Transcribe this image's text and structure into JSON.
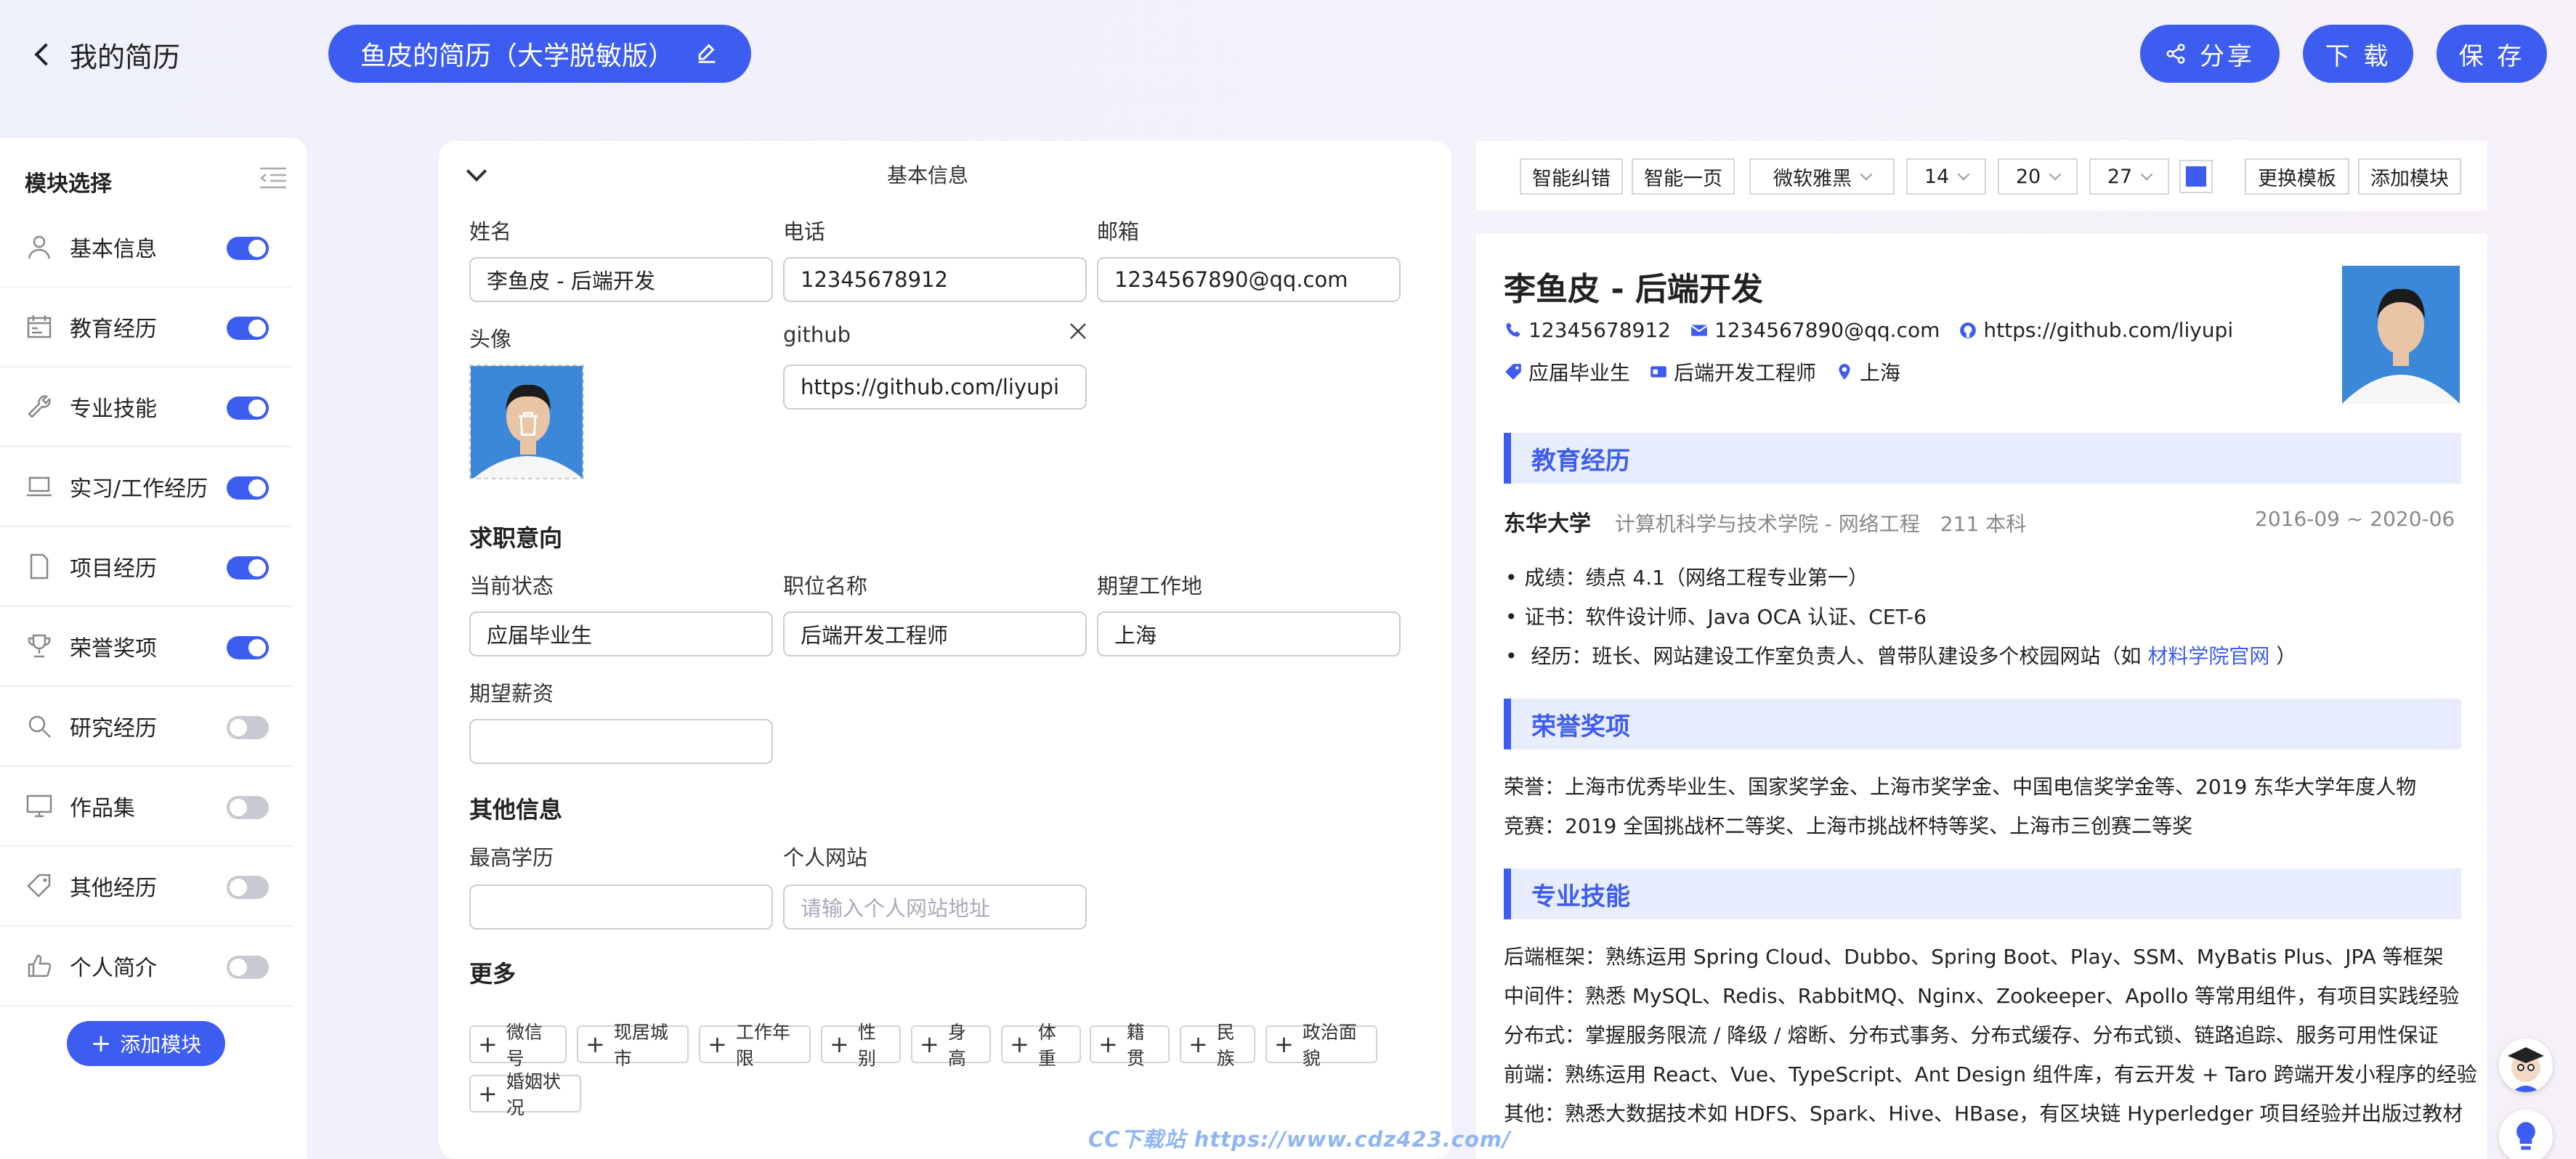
{
  "header": {
    "back_label": "我的简历",
    "resume_title": "鱼皮的简历（大学脱敏版）",
    "share_label": "分享",
    "download_label": "下 载",
    "save_label": "保 存"
  },
  "sidebar": {
    "title": "模块选择",
    "items": [
      {
        "label": "基本信息",
        "icon": "user-icon",
        "enabled": true
      },
      {
        "label": "教育经历",
        "icon": "calendar-icon",
        "enabled": true
      },
      {
        "label": "专业技能",
        "icon": "wrench-icon",
        "enabled": true
      },
      {
        "label": "实习/工作经历",
        "icon": "laptop-icon",
        "enabled": true
      },
      {
        "label": "项目经历",
        "icon": "file-icon",
        "enabled": true
      },
      {
        "label": "荣誉奖项",
        "icon": "trophy-icon",
        "enabled": true
      },
      {
        "label": "研究经历",
        "icon": "search-icon",
        "enabled": false
      },
      {
        "label": "作品集",
        "icon": "desktop-icon",
        "enabled": false
      },
      {
        "label": "其他经历",
        "icon": "tag-icon",
        "enabled": false
      },
      {
        "label": "个人简介",
        "icon": "thumbs-up-icon",
        "enabled": false
      }
    ],
    "add_module_label": "添加模块"
  },
  "form": {
    "section_title": "基本信息",
    "name_label": "姓名",
    "name_value": "李鱼皮 - 后端开发",
    "phone_label": "电话",
    "phone_value": "12345678912",
    "email_label": "邮箱",
    "email_value": "1234567890@qq.com",
    "avatar_label": "头像",
    "github_label": "github",
    "github_value": "https://github.com/liyupi",
    "intent_title": "求职意向",
    "status_label": "当前状态",
    "status_value": "应届毕业生",
    "position_label": "职位名称",
    "position_value": "后端开发工程师",
    "location_label": "期望工作地",
    "location_value": "上海",
    "salary_label": "期望薪资",
    "salary_value": "",
    "other_title": "其他信息",
    "degree_label": "最高学历",
    "degree_value": "",
    "website_label": "个人网站",
    "website_placeholder": "请输入个人网站地址",
    "more_title": "更多",
    "more_tags": [
      "微信号",
      "现居城市",
      "工作年限",
      "性别",
      "身高",
      "体重",
      "籍贯",
      "民族",
      "政治面貌",
      "婚姻状况"
    ]
  },
  "toolbar": {
    "smart_fix": "智能纠错",
    "smart_page": "智能一页",
    "font": "微软雅黑",
    "font_size": "14",
    "line_height": "20",
    "spacing": "27",
    "theme_color": "#3d5cf0",
    "change_template": "更换模板",
    "add_module": "添加模块"
  },
  "preview": {
    "name": "李鱼皮 - 后端开发",
    "phone": "12345678912",
    "email": "1234567890@qq.com",
    "github": "https://github.com/liyupi",
    "status": "应届毕业生",
    "position": "后端开发工程师",
    "location": "上海",
    "edu_title": "教育经历",
    "school": "东华大学",
    "school_detail": "计算机科学与技术学院 - 网络工程　211 本科",
    "edu_dates": "2016-09 ~ 2020-06",
    "edu_bullets": [
      "成绩：绩点 4.1（网络工程专业第一）",
      "证书：软件设计师、Java OCA 认证、CET-6"
    ],
    "edu_bullet3_prefix": "经历：班长、网站建设工作室负责人、曾带队建设多个校园网站（如",
    "edu_bullet3_link": "材料学院官网",
    "edu_bullet3_suffix": "）",
    "honor_title": "荣誉奖项",
    "honor_lines": [
      "荣誉：上海市优秀毕业生、国家奖学金、上海市奖学金、中国电信奖学金等、2019 东华大学年度人物",
      "竞赛：2019 全国挑战杯二等奖、上海市挑战杯特等奖、上海市三创赛二等奖"
    ],
    "skills_title": "专业技能",
    "skill_lines": [
      "后端框架：熟练运用 Spring Cloud、Dubbo、Spring Boot、Play、SSM、MyBatis Plus、JPA 等框架",
      "中间件：熟悉 MySQL、Redis、RabbitMQ、Nginx、Zookeeper、Apollo 等常用组件，有项目实践经验",
      "分布式：掌握服务限流 / 降级 / 熔断、分布式事务、分布式缓存、分布式锁、链路追踪、服务可用性保证",
      "前端：熟练运用 React、Vue、TypeScript、Ant Design 组件库，有云开发 + Taro 跨端开发小程序的经验",
      "其他：熟悉大数据技术如 HDFS、Spark、Hive、HBase，有区块链 Hyperledger 项目经验并出版过教材"
    ]
  },
  "watermark": "CC下载站  https://www.cdz423.com/"
}
